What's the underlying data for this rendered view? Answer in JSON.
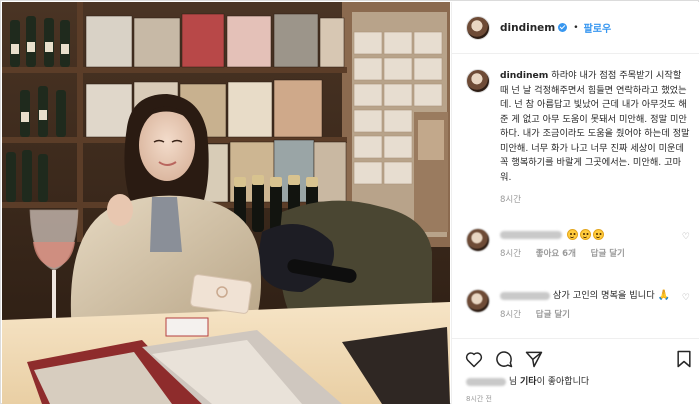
{
  "header": {
    "username": "dindinem",
    "verified": true,
    "separator": "•",
    "follow_label": "팔로우"
  },
  "caption": {
    "username": "dindinem",
    "text": "하라야 내가 점점 주목받기 시작할 때 넌 날 걱정해주면서 힘들면 연락하라고 했었는데. 넌 참 아름답고 빛났어 근데 내가 아무것도 해준 게 없고 아무 도움이 못돼서 미안해. 정말 미안하다. 내가 조금이라도 도움을 줬어야 하는데 정말 미안해. 너무 화가 나고 너무 진짜 세상이 미운데 꼭 행복하기를 바랄게 그곳에서는. 미안해. 고마워.",
    "time": "8시간"
  },
  "comments": [
    {
      "emoji_count": 3,
      "time": "8시간",
      "likes": "좋아요 6개",
      "reply": "답글 달기"
    },
    {
      "text": "삼가 고인의 명복을 빕니다",
      "emoji": "🙏",
      "time": "8시간",
      "reply": "답글 달기"
    }
  ],
  "actions": {
    "icons": [
      "heart-icon",
      "comment-icon",
      "share-icon",
      "bookmark-icon"
    ]
  },
  "likes": {
    "and_label": "님",
    "others": "기타",
    "suffix": "이 좋아합니다"
  },
  "timestamp": "8시간 전",
  "colors": {
    "accent": "#3897f0",
    "text": "#262626",
    "muted": "#999999",
    "border": "#efefef"
  }
}
